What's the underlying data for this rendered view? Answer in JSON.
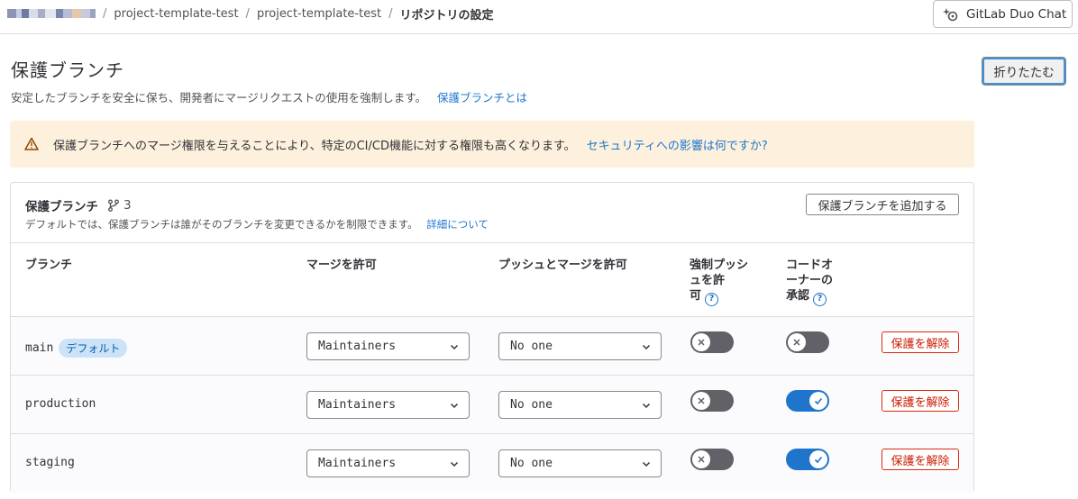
{
  "breadcrumb": {
    "items": [
      "project-template-test",
      "project-template-test",
      "リポジトリの設定"
    ]
  },
  "duo_chat": {
    "label": "GitLab Duo Chat"
  },
  "section": {
    "title": "保護ブランチ",
    "description": "安定したブランチを安全に保ち、開発者にマージリクエストの使用を強制します。",
    "help_link": "保護ブランチとは",
    "collapse_label": "折りたたむ"
  },
  "warning": {
    "text": "保護ブランチへのマージ権限を与えることにより、特定のCI/CD機能に対する権限も高くなります。",
    "link": "セキュリティへの影響は何ですか?"
  },
  "card": {
    "title": "保護ブランチ",
    "count": "3",
    "description": "デフォルトでは、保護ブランチは誰がそのブランチを変更できるかを制限できます。",
    "details_link": "詳細について",
    "add_label": "保護ブランチを追加する"
  },
  "table": {
    "columns": {
      "branch": "ブランチ",
      "merge": "マージを許可",
      "push": "プッシュとマージを許可",
      "force_push_1": "強制プッシ",
      "force_push_2": "ュを許",
      "force_push_3": "可",
      "code_owner_1": "コードオ",
      "code_owner_2": "ーナーの",
      "code_owner_3": "承認",
      "help_glyph": "?"
    },
    "rows": [
      {
        "branch": "main",
        "badge": "デフォルト",
        "merge": "Maintainers",
        "push": "No one",
        "force_push": false,
        "code_owner": false,
        "unprotect": "保護を解除"
      },
      {
        "branch": "production",
        "merge": "Maintainers",
        "push": "No one",
        "force_push": false,
        "code_owner": true,
        "unprotect": "保護を解除"
      },
      {
        "branch": "staging",
        "merge": "Maintainers",
        "push": "No one",
        "force_push": false,
        "code_owner": true,
        "unprotect": "保護を解除"
      }
    ]
  },
  "colors": {
    "link": "#1f75cb",
    "warning_bg": "#fdf1dd",
    "toggle_on": "#1f75cb",
    "toggle_off": "#626168",
    "danger": "#dd2b0e"
  }
}
